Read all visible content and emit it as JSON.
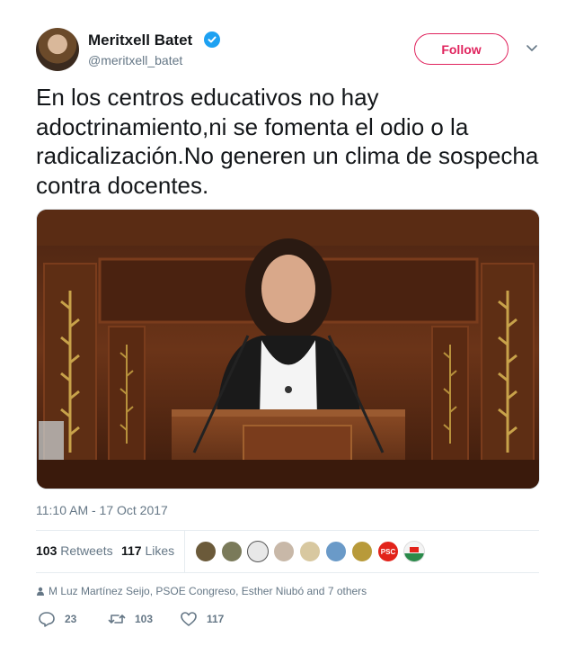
{
  "author": {
    "name": "Meritxell Batet",
    "handle": "@meritxell_batet"
  },
  "follow_label": "Follow",
  "tweet": {
    "text": "En los centros educativos no hay adoctrinamiento,ni se fomenta el odio o la radicalización.No generen un clima de sospecha contra docentes.",
    "timestamp": "11:10 AM - 17 Oct 2017"
  },
  "stats": {
    "retweets_count": "103",
    "retweets_label": "Retweets",
    "likes_count": "117",
    "likes_label": "Likes"
  },
  "social_context": "M Luz Martínez Seijo, PSOE Congreso, Esther Niubó and 7 others",
  "actions": {
    "replies": "23",
    "retweets": "103",
    "likes": "117"
  },
  "liker_avatar_labels": [
    "PSC"
  ],
  "colors": {
    "accent": "#e0245e",
    "verified": "#1da1f2",
    "secondary_text": "#657786"
  }
}
